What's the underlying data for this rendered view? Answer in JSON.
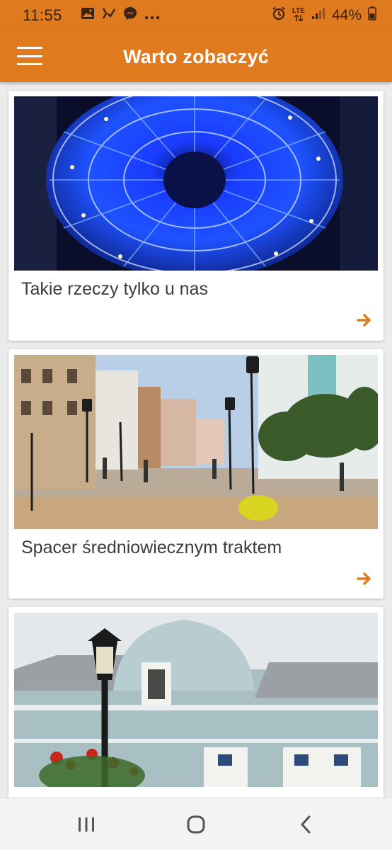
{
  "status_bar": {
    "time": "11:55",
    "notification_icons": [
      "gallery-icon",
      "tasks-icon",
      "messenger-icon",
      "more-dots-icon"
    ],
    "network_label": "LTE",
    "battery_percent": "44%"
  },
  "app_bar": {
    "title": "Warto zobaczyć",
    "menu_icon": "hamburger-menu-icon"
  },
  "cards": [
    {
      "title": "Takie rzeczy tylko u nas",
      "image": "blue illuminated ceiling lattice",
      "arrow_icon": "chevron-right-icon"
    },
    {
      "title": "Spacer średniowiecznym traktem",
      "image": "pedestrian street with lamps",
      "arrow_icon": "chevron-right-icon"
    },
    {
      "title": "",
      "image": "ornate pale blue building facade with street lamp",
      "arrow_icon": "chevron-right-icon"
    }
  ],
  "nav_bar": {
    "recent_icon": "recent-apps-icon",
    "home_icon": "home-icon",
    "back_icon": "back-icon"
  },
  "colors": {
    "primary": "#e07a1f",
    "background": "#ebebeb",
    "card": "#ffffff",
    "title_text": "#3c3c3c"
  }
}
